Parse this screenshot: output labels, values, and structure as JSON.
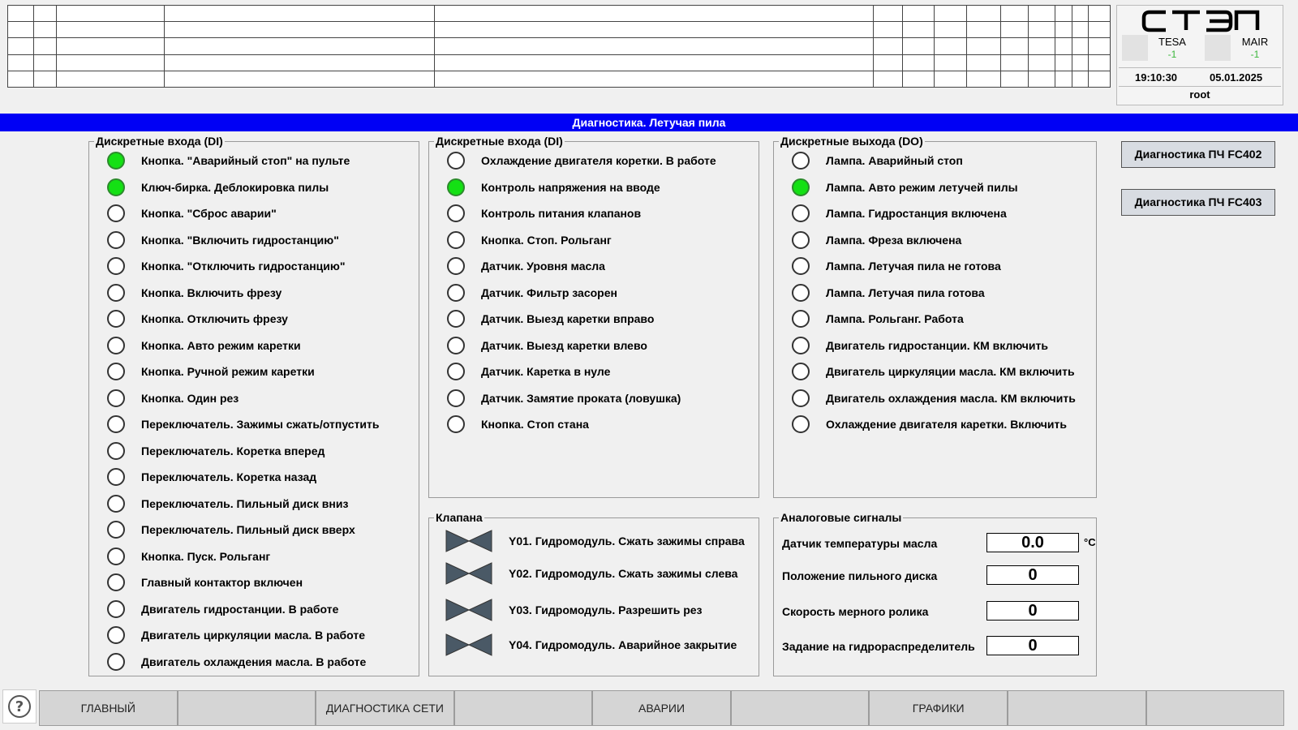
{
  "header": {
    "logo_text": "СТЭП",
    "indicators": [
      {
        "name": "TESA",
        "value": "-1"
      },
      {
        "name": "MAIR",
        "value": "-1"
      }
    ],
    "time": "19:10:30",
    "date": "05.01.2025",
    "user": "root"
  },
  "banner": {
    "title": "Диагностика. Летучая пила"
  },
  "di_left": {
    "title": "Дискретные входа (DI)",
    "items": [
      {
        "label": "Кнопка. \"Аварийный стоп\" на пульте",
        "on": true
      },
      {
        "label": "Ключ-бирка. Деблокировка пилы",
        "on": true
      },
      {
        "label": "Кнопка. \"Сброс аварии\"",
        "on": false
      },
      {
        "label": "Кнопка. \"Включить гидростанцию\"",
        "on": false
      },
      {
        "label": "Кнопка. \"Отключить гидростанцию\"",
        "on": false
      },
      {
        "label": "Кнопка. Включить фрезу",
        "on": false
      },
      {
        "label": "Кнопка. Отключить фрезу",
        "on": false
      },
      {
        "label": "Кнопка. Авто режим каретки",
        "on": false
      },
      {
        "label": "Кнопка. Ручной режим каретки",
        "on": false
      },
      {
        "label": "Кнопка. Один рез",
        "on": false
      },
      {
        "label": "Переключатель. Зажимы сжать/отпустить",
        "on": false
      },
      {
        "label": "Переключатель. Коретка вперед",
        "on": false
      },
      {
        "label": "Переключатель. Коретка назад",
        "on": false
      },
      {
        "label": "Переключатель. Пильный диск вниз",
        "on": false
      },
      {
        "label": "Переключатель. Пильный диск вверх",
        "on": false
      },
      {
        "label": "Кнопка. Пуск. Рольганг",
        "on": false
      },
      {
        "label": "Главный контактор включен",
        "on": false
      },
      {
        "label": "Двигатель гидростанции. В работе",
        "on": false
      },
      {
        "label": "Двигатель циркуляции масла. В работе",
        "on": false
      },
      {
        "label": "Двигатель охлаждения масла. В работе",
        "on": false
      }
    ]
  },
  "di_mid": {
    "title": "Дискретные входа (DI)",
    "items": [
      {
        "label": "Охлаждение двигателя коретки. В работе",
        "on": false
      },
      {
        "label": "Контроль напряжения на вводе",
        "on": true
      },
      {
        "label": "Контроль питания клапанов",
        "on": false
      },
      {
        "label": "Кнопка. Стоп. Рольганг",
        "on": false
      },
      {
        "label": "Датчик. Уровня масла",
        "on": false
      },
      {
        "label": "Датчик. Фильтр засорен",
        "on": false
      },
      {
        "label": "Датчик. Выезд каретки вправо",
        "on": false
      },
      {
        "label": "Датчик. Выезд каретки влево",
        "on": false
      },
      {
        "label": "Датчик. Каретка в нуле",
        "on": false
      },
      {
        "label": "Датчик. Замятие проката (ловушка)",
        "on": false
      },
      {
        "label": "Кнопка. Стоп стана",
        "on": false
      }
    ]
  },
  "do_right": {
    "title": "Дискретные выхода (DO)",
    "items": [
      {
        "label": "Лампа. Аварийный стоп",
        "on": false
      },
      {
        "label": "Лампа. Авто режим летучей пилы",
        "on": true
      },
      {
        "label": "Лампа. Гидростанция включена",
        "on": false
      },
      {
        "label": "Лампа. Фреза включена",
        "on": false
      },
      {
        "label": "Лампа. Летучая пила не готова",
        "on": false
      },
      {
        "label": "Лампа. Летучая пила готова",
        "on": false
      },
      {
        "label": "Лампа. Рольганг. Работа",
        "on": false
      },
      {
        "label": "Двигатель гидростанции. КМ включить",
        "on": false
      },
      {
        "label": "Двигатель циркуляции масла. КМ включить",
        "on": false
      },
      {
        "label": "Двигатель охлаждения масла. КМ включить",
        "on": false
      },
      {
        "label": "Охлаждение двигателя каретки. Включить",
        "on": false
      }
    ]
  },
  "valves": {
    "title": "Клапана",
    "items": [
      {
        "label": "Y01. Гидромодуль. Сжать зажимы справа"
      },
      {
        "label": "Y02. Гидромодуль. Сжать зажимы слева"
      },
      {
        "label": "Y03. Гидромодуль. Разрешить рез"
      },
      {
        "label": "Y04. Гидромодуль. Аварийное закрытие"
      }
    ]
  },
  "analog": {
    "title": "Аналоговые сигналы",
    "items": [
      {
        "label": "Датчик температуры масла",
        "value": "0.0",
        "unit": "°C"
      },
      {
        "label": "Положение пильного диска",
        "value": "0",
        "unit": ""
      },
      {
        "label": "Скорость мерного ролика",
        "value": "0",
        "unit": ""
      },
      {
        "label": "Задание на гидрораспределитель",
        "value": "0",
        "unit": ""
      }
    ]
  },
  "side_buttons": {
    "fc402": "Диагностика ПЧ FC402",
    "fc403": "Диагностика ПЧ FC403"
  },
  "nav": {
    "buttons": [
      "ГЛАВНЫЙ",
      "",
      "ДИАГНОСТИКА СЕТИ",
      "",
      "АВАРИИ",
      "",
      "ГРАФИКИ",
      "",
      ""
    ]
  },
  "colors": {
    "banner": "#0000f5",
    "led_on": "#14e014",
    "valve": "#4a5966"
  }
}
